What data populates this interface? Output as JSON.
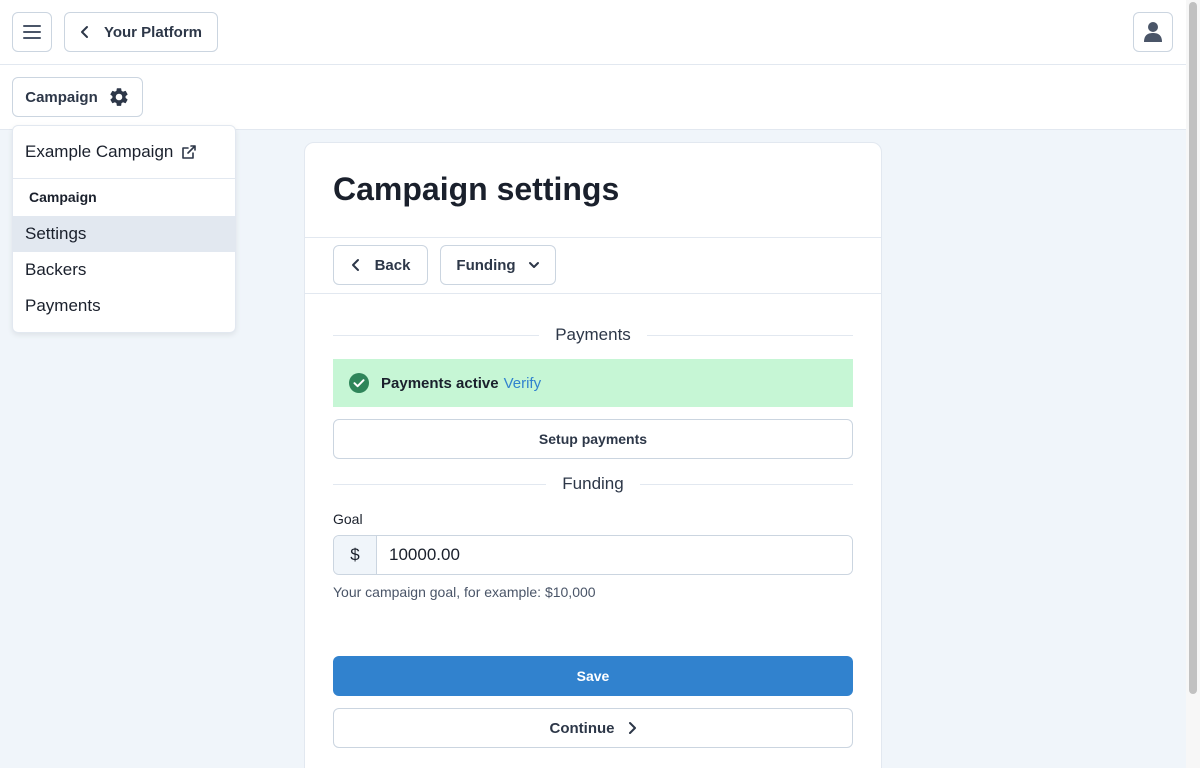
{
  "topbar": {
    "menu_icon": "hamburger-menu-icon",
    "back_label": "Your Platform",
    "user_icon": "user-icon"
  },
  "subbar": {
    "campaign_button_label": "Campaign",
    "campaign_button_icon": "gear-icon"
  },
  "dropdown": {
    "external_link_label": "Example Campaign",
    "external_link_icon": "external-link-icon",
    "section_heading": "Campaign",
    "items": [
      {
        "label": "Settings",
        "active": true
      },
      {
        "label": "Backers",
        "active": false
      },
      {
        "label": "Payments",
        "active": false
      }
    ]
  },
  "card": {
    "title": "Campaign settings",
    "back_button_label": "Back",
    "section_select_label": "Funding",
    "payments_section_title": "Payments",
    "payments_status_text": "Payments active",
    "payments_verify_link": "Verify",
    "setup_payments_label": "Setup payments",
    "funding_section_title": "Funding",
    "goal_label": "Goal",
    "goal_prefix": "$",
    "goal_value": "10000.00",
    "goal_help": "Your campaign goal, for example: $10,000",
    "save_label": "Save",
    "continue_label": "Continue"
  },
  "colors": {
    "primary": "#3182ce",
    "success_bg": "#c6f6d5",
    "success_icon": "#2f855a",
    "active_item_bg": "#e2e8f0"
  }
}
